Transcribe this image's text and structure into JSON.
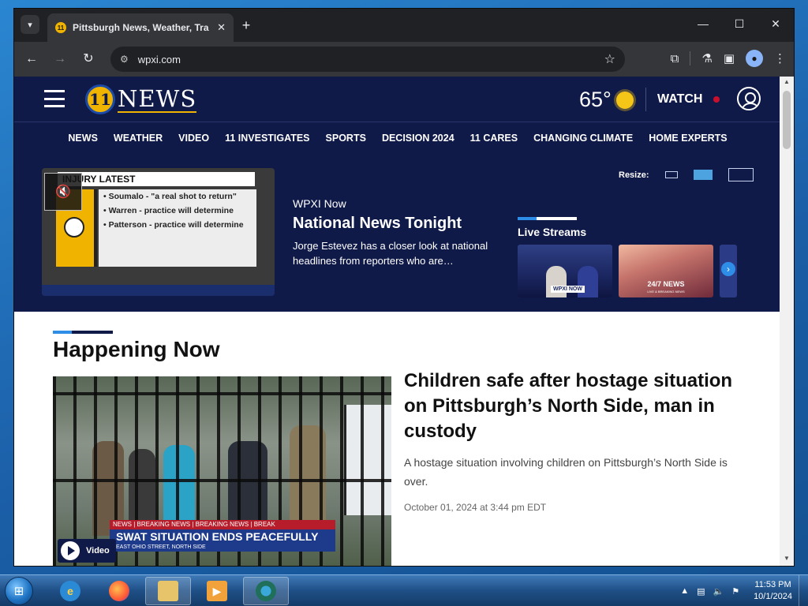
{
  "browser": {
    "tab_title": "Pittsburgh News, Weather, Tra",
    "tab_favicon_text": "11",
    "url": "wpxi.com",
    "window_controls": [
      "—",
      "☐",
      "✕"
    ]
  },
  "site": {
    "logo_mark": "11",
    "logo_text": "NEWS",
    "temperature": "65°",
    "watch_label": "WATCH",
    "nav": [
      "NEWS",
      "WEATHER",
      "VIDEO",
      "11 INVESTIGATES",
      "SPORTS",
      "DECISION 2024",
      "11 CARES",
      "CHANGING CLIMATE",
      "HOME EXPERTS"
    ]
  },
  "hero": {
    "video_graphic": {
      "header": "INJURY LATEST",
      "items": [
        "• Soumalo - \"a real shot to return\"",
        "• Warren - practice will determine",
        "• Patterson - practice will determine"
      ]
    },
    "eyebrow": "WPXI Now",
    "title": "National News Tonight",
    "description": "Jorge Estevez has a closer look at national headlines from reporters who are…",
    "resize_label": "Resize:",
    "live_streams_title": "Live Streams",
    "stream_1_label": "WPXI NOW",
    "stream_2_label": "24/7 NEWS",
    "stream_2_sublabel": "LIVE & BREAKING NEWS"
  },
  "main": {
    "section_title": "Happening Now",
    "story": {
      "headline": "Children safe after hostage situation on Pittsburgh’s North Side, man in custody",
      "summary": "A hostage situation involving children on Pittsburgh’s North Side is over.",
      "date": "October 01, 2024 at 3:44 pm EDT",
      "ticker_crawl": "NEWS  |  BREAKING NEWS  |  BREAKING NEWS  |  BREAK",
      "ticker_headline": "SWAT SITUATION ENDS PEACEFULLY",
      "ticker_subhead": "EAST OHIO STREET, NORTH SIDE",
      "video_badge": "Video"
    }
  },
  "taskbar": {
    "time": "11:53 PM",
    "date": "10/1/2024"
  },
  "colors": {
    "site_navy": "#101a48",
    "accent_blue": "#2e8de6",
    "brand_gold": "#f0b400",
    "live_red": "#c8102e"
  }
}
